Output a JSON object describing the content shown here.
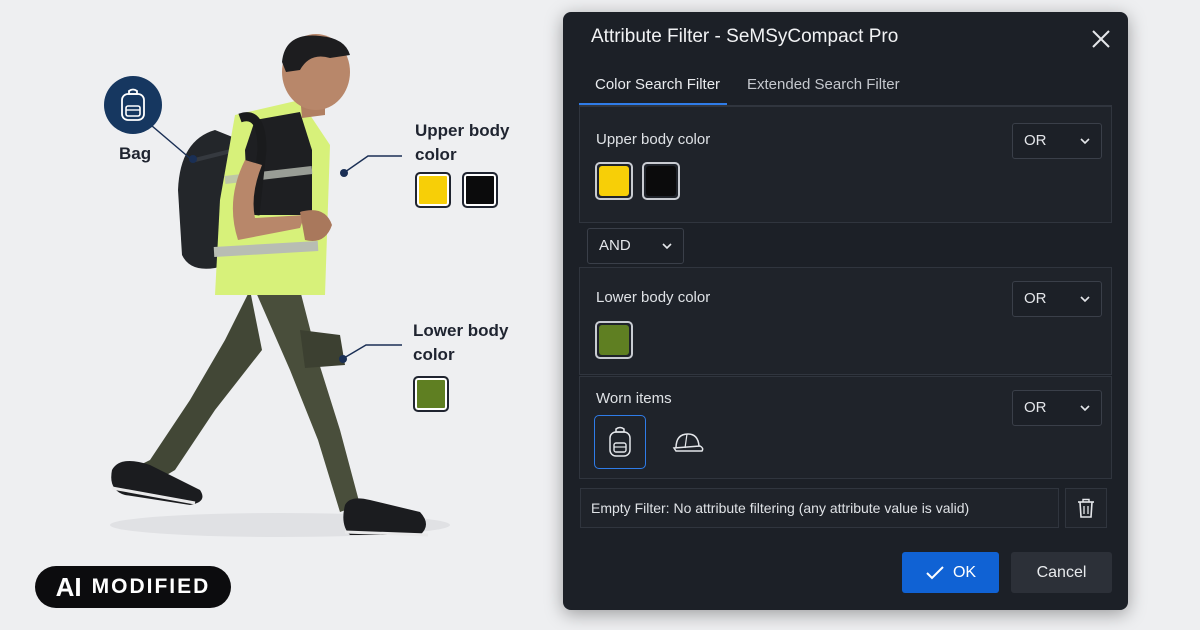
{
  "illustration": {
    "bag_label": "Bag",
    "upper_label": "Upper body color",
    "lower_label": "Lower body color",
    "upper_swatches": [
      "#f7cf07",
      "#0b0b0c"
    ],
    "lower_swatches": [
      "#5f7f22"
    ],
    "ai_badge": {
      "ai": "AI",
      "modified": "MODIFIED"
    }
  },
  "dialog": {
    "title": "Attribute Filter - SeMSyCompact Pro",
    "tabs": [
      {
        "label": "Color Search Filter",
        "active": true
      },
      {
        "label": "Extended Search Filter",
        "active": false
      }
    ],
    "upper": {
      "label": "Upper body color",
      "operator": "OR",
      "swatches": [
        "#f7cf07",
        "#0b0b0c"
      ]
    },
    "joiner": "AND",
    "lower": {
      "label": "Lower body color",
      "operator": "OR",
      "swatches": [
        "#5f7f22"
      ]
    },
    "worn": {
      "label": "Worn items",
      "operator": "OR",
      "items": [
        "backpack-icon",
        "cap-icon"
      ],
      "selected": "backpack-icon"
    },
    "empty_filter_text": "Empty Filter: No attribute filtering (any attribute value is valid)",
    "ok_label": "OK",
    "cancel_label": "Cancel",
    "accent": "#1062d4"
  }
}
